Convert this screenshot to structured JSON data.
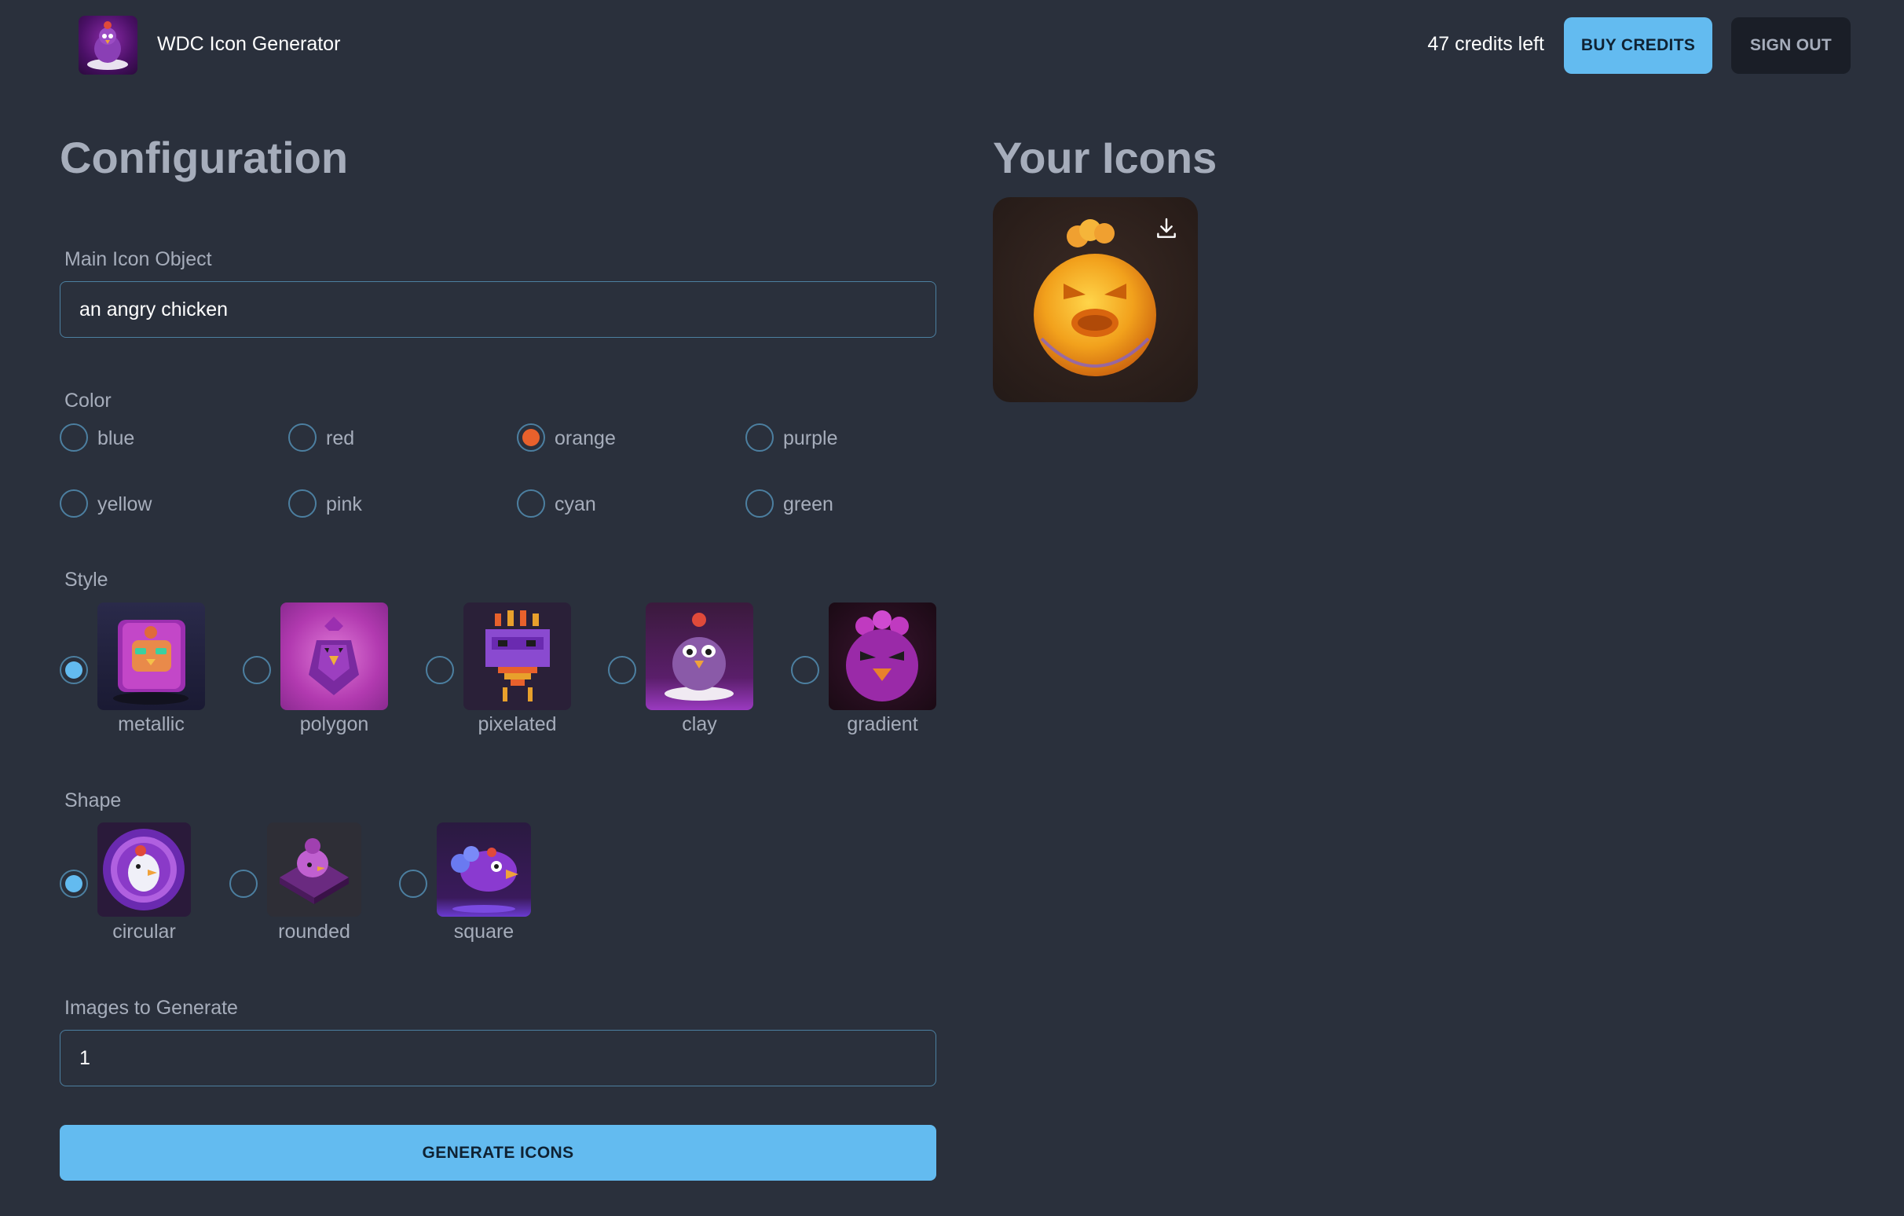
{
  "header": {
    "brand": "WDC Icon Generator",
    "credits": "47 credits left",
    "buy_label": "BUY CREDITS",
    "signout_label": "SIGN OUT"
  },
  "config": {
    "title": "Configuration",
    "main_object": {
      "label": "Main Icon Object",
      "value": "an angry chicken"
    },
    "color": {
      "label": "Color",
      "options": [
        "blue",
        "red",
        "orange",
        "purple",
        "yellow",
        "pink",
        "cyan",
        "green"
      ],
      "selected": "orange",
      "accent": "#e8612c"
    },
    "style": {
      "label": "Style",
      "options": [
        "metallic",
        "polygon",
        "pixelated",
        "clay",
        "gradient"
      ],
      "selected": "metallic"
    },
    "shape": {
      "label": "Shape",
      "options": [
        "circular",
        "rounded",
        "square"
      ],
      "selected": "circular"
    },
    "images_to_generate": {
      "label": "Images to Generate",
      "value": "1"
    },
    "generate_label": "GENERATE ICONS"
  },
  "results": {
    "title": "Your Icons",
    "items": [
      {
        "icon": "angry-chicken-orange-icon",
        "action_icon": "download-icon"
      }
    ]
  },
  "colors": {
    "background": "#2a303c",
    "primary": "#63bbf0",
    "selected_color": "#e8612c",
    "dark_button": "#1a1e27"
  }
}
